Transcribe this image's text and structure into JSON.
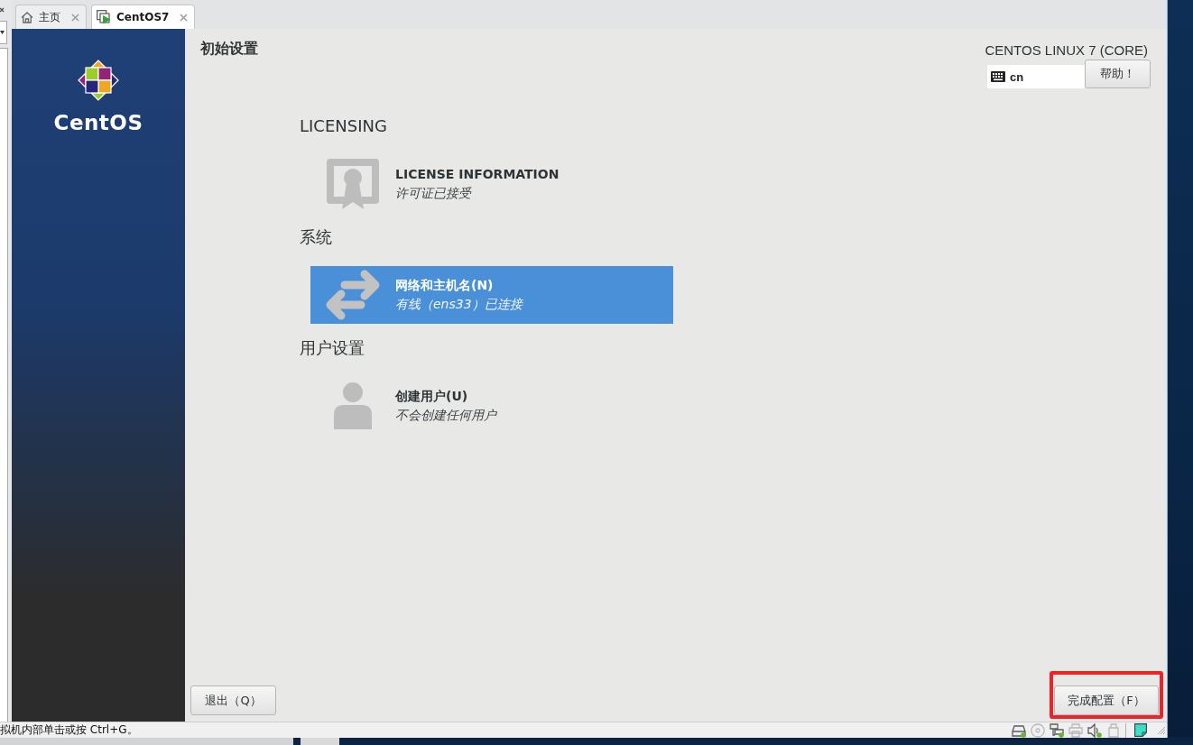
{
  "tabs": [
    {
      "kind": "home",
      "label": "主页",
      "selected": false
    },
    {
      "kind": "vm",
      "label": "CentOS7",
      "selected": true
    }
  ],
  "sidebar": {
    "brand": "CentOS"
  },
  "header": {
    "title": "初始设置",
    "product": "CENTOS LINUX 7 (CORE)",
    "keyboard_layout": "cn",
    "help_button": "帮助！"
  },
  "sections": [
    {
      "title": "LICENSING",
      "spokes": [
        {
          "kind": "license",
          "title": "LICENSE INFORMATION",
          "status": "许可证已接受",
          "selected": false
        }
      ]
    },
    {
      "title": "系统",
      "spokes": [
        {
          "kind": "network",
          "title": "网络和主机名(N)",
          "status": "有线（ens33）已连接",
          "selected": true
        }
      ]
    },
    {
      "title": "用户设置",
      "spokes": [
        {
          "kind": "user",
          "title": "创建用户(U)",
          "status": "不会创建任何用户",
          "selected": false
        }
      ]
    }
  ],
  "footer": {
    "quit_button": "退出（Q）",
    "finish_button": {
      "label": "完成配置（F）",
      "highlighted": true
    }
  },
  "status_bar": {
    "hint": "拟机内部单击或按 Ctrl+G。",
    "devices": [
      {
        "kind": "disk",
        "connected": true
      },
      {
        "kind": "cd",
        "connected": false
      },
      {
        "kind": "network",
        "connected": true
      },
      {
        "kind": "printer",
        "connected": false
      },
      {
        "kind": "sound",
        "connected": true
      },
      {
        "kind": "usb",
        "connected": false
      }
    ]
  }
}
